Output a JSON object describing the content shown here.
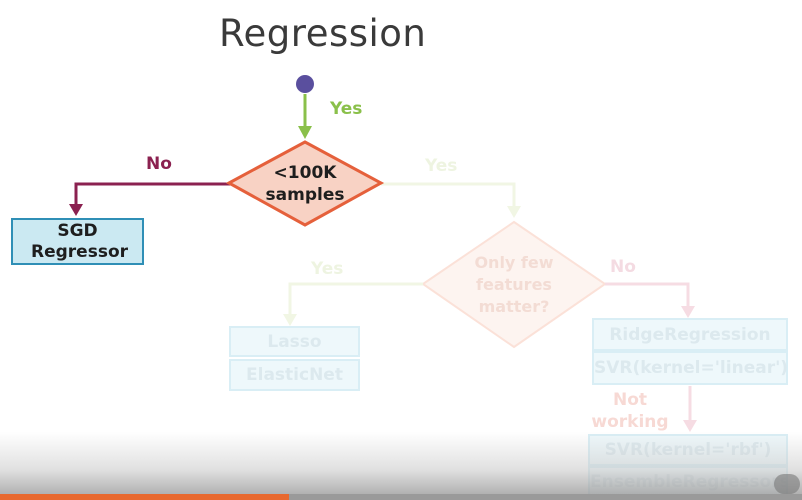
{
  "title": "Regression",
  "colors": {
    "start_dot": "#5a4f9e",
    "yes_green": "#8ac04a",
    "no_maroon": "#8b2150",
    "decision_fill": "#f8d2c4",
    "decision_stroke": "#e5603b",
    "box_fill": "#cbe9f2",
    "box_stroke": "#2f8fb6",
    "progress": "#e8692f"
  },
  "edges": {
    "start_yes": "Yes",
    "decision1_no": "No",
    "decision1_yes": "Yes",
    "decision2_yes": "Yes",
    "decision2_no": "No",
    "not_working": "Not working"
  },
  "nodes": {
    "decision1": "<100K samples",
    "decision2": "Only few features matter?",
    "sgd": "SGD Regressor",
    "lasso": "Lasso",
    "elasticnet": "ElasticNet",
    "ridge": "RidgeRegression",
    "svr_linear": "SVR(kernel='linear')",
    "svr_rbf": "SVR(kernel='rbf')",
    "ensemble": "EnsembleRegressors"
  },
  "video": {
    "progress_fraction": 0.36
  }
}
